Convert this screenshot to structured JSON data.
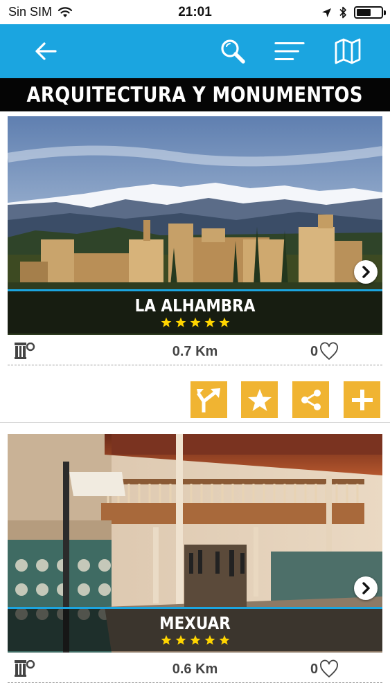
{
  "status_bar": {
    "carrier": "Sin SIM",
    "time": "21:01",
    "battery_level": 0.6
  },
  "app_bar": {
    "icons": [
      "back-arrow-icon",
      "search-icon",
      "menu-icon",
      "map-icon"
    ]
  },
  "page_title": "ARQUITECTURA Y MONUMENTOS",
  "colors": {
    "app_bar": "#1ba5e0",
    "title_banner": "#050505",
    "action_button": "#f0b432",
    "star": "#ffd500"
  },
  "places": [
    {
      "name": "LA ALHAMBRA",
      "rating": 5,
      "distance": "0.7 Km",
      "likes": "0",
      "category_icon": "monument-icon"
    },
    {
      "name": "MEXUAR",
      "rating": 5,
      "distance": "0.6 Km",
      "likes": "0",
      "category_icon": "monument-icon"
    }
  ],
  "actions": [
    "directions-icon",
    "favorite-icon",
    "share-icon",
    "add-icon"
  ]
}
